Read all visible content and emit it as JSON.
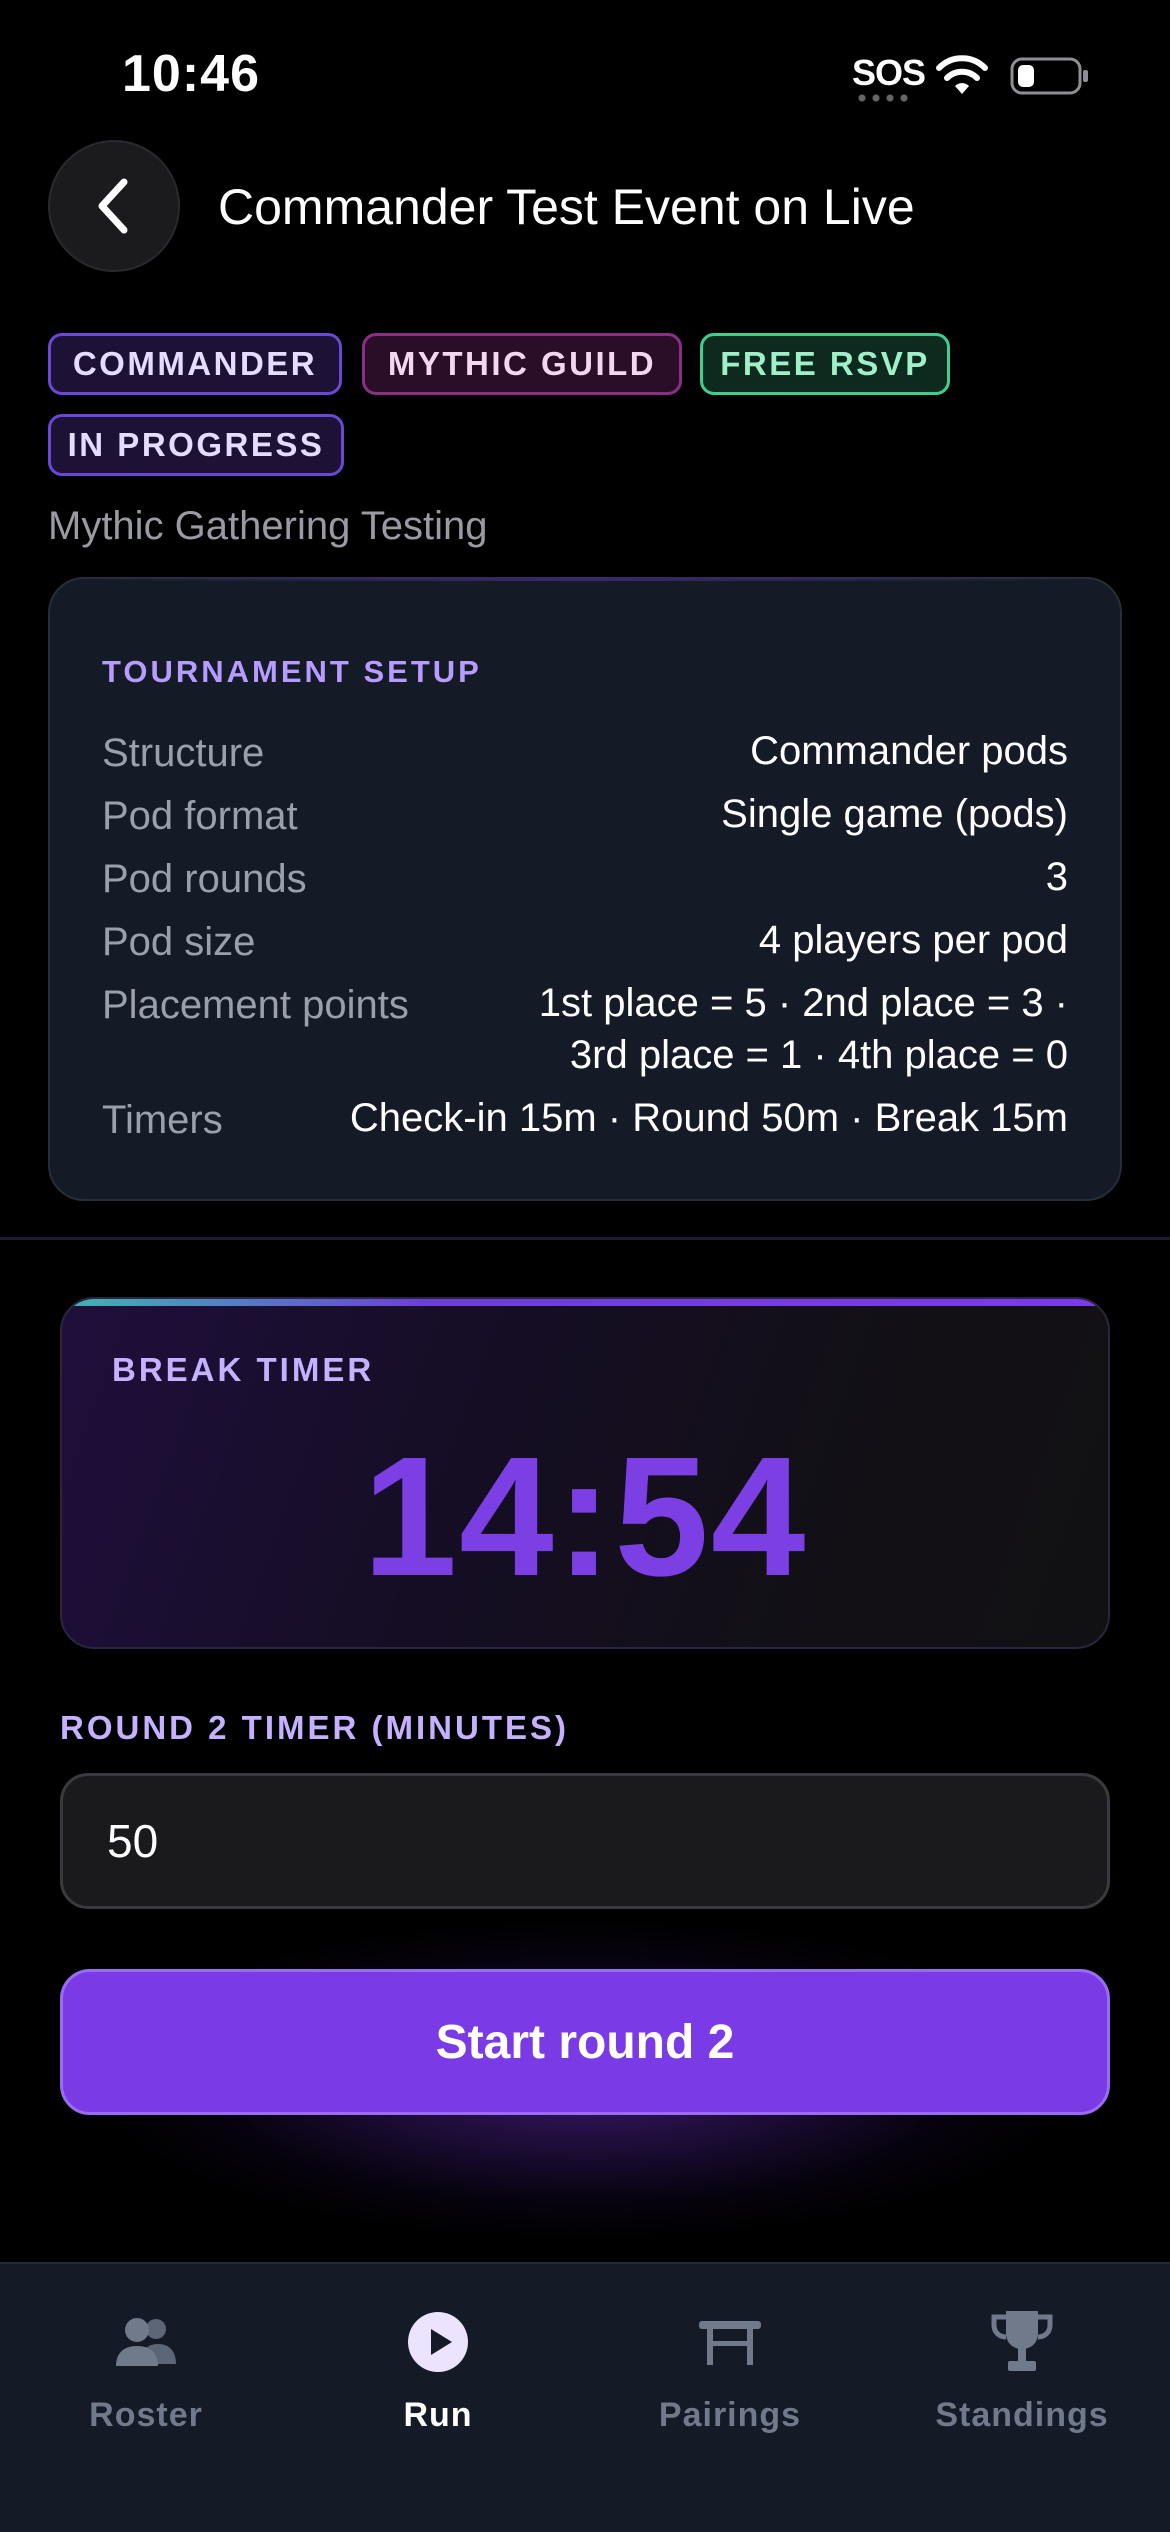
{
  "status_bar": {
    "time": "10:46",
    "sos": "SOS"
  },
  "header": {
    "title": "Commander Test Event on Live"
  },
  "tags": {
    "format": "COMMANDER",
    "guild": "MYTHIC GUILD",
    "rsvp": "FREE RSVP",
    "status": "IN PROGRESS"
  },
  "organizer": "Mythic Gathering Testing",
  "setup": {
    "heading": "TOURNAMENT SETUP",
    "rows": [
      {
        "label": "Structure",
        "value": "Commander pods"
      },
      {
        "label": "Pod format",
        "value": "Single game (pods)"
      },
      {
        "label": "Pod rounds",
        "value": "3"
      },
      {
        "label": "Pod size",
        "value": "4 players per pod"
      },
      {
        "label": "Placement points",
        "value_line1": "1st place = 5 · 2nd place = 3 ·",
        "value_line2": "3rd place = 1 · 4th place = 0"
      },
      {
        "label": "Timers",
        "value": "Check-in 15m · Round 50m · Break 15m"
      }
    ]
  },
  "break_timer": {
    "label": "BREAK TIMER",
    "value": "14:54"
  },
  "round_timer": {
    "label": "ROUND 2 TIMER (MINUTES)",
    "value": "50"
  },
  "actions": {
    "start_label": "Start round 2"
  },
  "tabs": [
    {
      "label": "Roster",
      "icon": "people-icon",
      "active": false
    },
    {
      "label": "Run",
      "icon": "play-icon",
      "active": true
    },
    {
      "label": "Pairings",
      "icon": "table-icon",
      "active": false
    },
    {
      "label": "Standings",
      "icon": "trophy-icon",
      "active": false
    }
  ],
  "colors": {
    "accent": "#7a3be6",
    "timer": "#7b3fe4",
    "success": "#3ecf8e"
  }
}
